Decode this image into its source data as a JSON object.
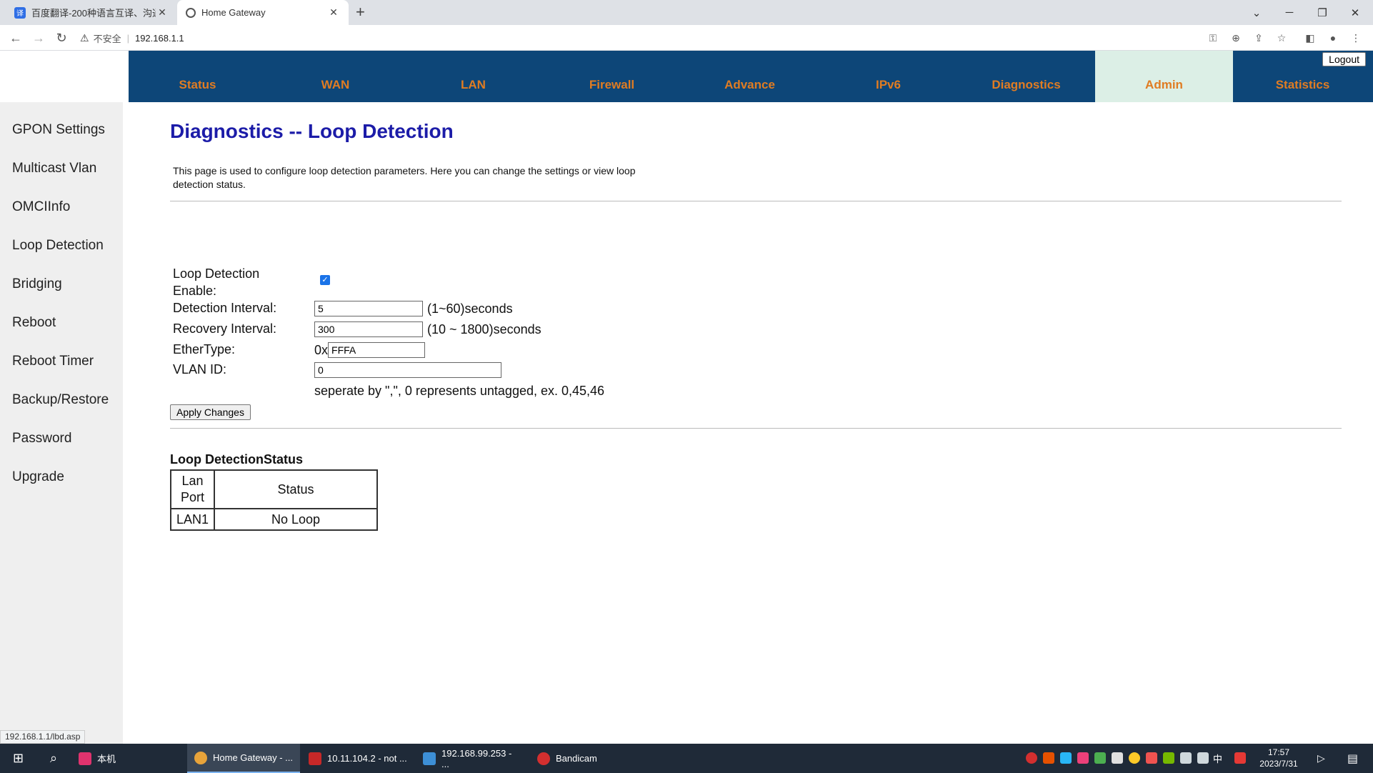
{
  "browser": {
    "tabs": [
      {
        "title": "百度翻译-200种语言互译、沟通",
        "active": false
      },
      {
        "title": "Home Gateway",
        "active": true
      }
    ],
    "address": {
      "warning": "不安全",
      "url": "192.168.1.1"
    },
    "status_url": "192.168.1.1/lbd.asp"
  },
  "topnav": {
    "items": [
      "Status",
      "WAN",
      "LAN",
      "Firewall",
      "Advance",
      "IPv6",
      "Diagnostics",
      "Admin",
      "Statistics"
    ],
    "active": "Admin",
    "logout_label": "Logout"
  },
  "sidebar": {
    "items": [
      "GPON Settings",
      "Multicast Vlan",
      "OMCIInfo",
      "Loop Detection",
      "Bridging",
      "Reboot",
      "Reboot Timer",
      "Backup/Restore",
      "Password",
      "Upgrade"
    ]
  },
  "main": {
    "title": "Diagnostics -- Loop Detection",
    "description": "This page is used to configure loop detection parameters. Here you can change the settings or view loop detection status.",
    "form": {
      "enable_label_1": "Loop Detection",
      "enable_label_2": "Enable:",
      "enable_checked": true,
      "interval_label": "Detection Interval:",
      "interval_value": "5",
      "interval_hint": "(1~60)seconds",
      "recovery_label": "Recovery Interval:",
      "recovery_value": "300",
      "recovery_hint": "(10 ~ 1800)seconds",
      "ethertype_label": "EtherType:",
      "ethertype_prefix": "0x",
      "ethertype_value": "FFFA",
      "vlan_label": "VLAN ID:",
      "vlan_value": "0",
      "vlan_hint": "seperate by \",\", 0 represents untagged, ex. 0,45,46",
      "apply_label": "Apply Changes"
    },
    "status": {
      "title": "Loop DetectionStatus",
      "header_port_1": "Lan",
      "header_port_2": "Port",
      "header_status": "Status",
      "rows": [
        {
          "port": "LAN1",
          "status": "No Loop"
        }
      ]
    }
  },
  "taskbar": {
    "items": [
      {
        "label": "本机",
        "color": "#e0336e"
      },
      {
        "label": "Home Gateway - ...",
        "color": "#e8a33a"
      },
      {
        "label": "10.11.104.2 - not ...",
        "color": "#c62828"
      },
      {
        "label": "192.168.99.253 - ...",
        "color": "#3d8fd6"
      },
      {
        "label": "Bandicam",
        "color": "#d32f2f"
      }
    ],
    "clock_time": "17:57",
    "clock_date": "2023/7/31",
    "ime": "中"
  }
}
